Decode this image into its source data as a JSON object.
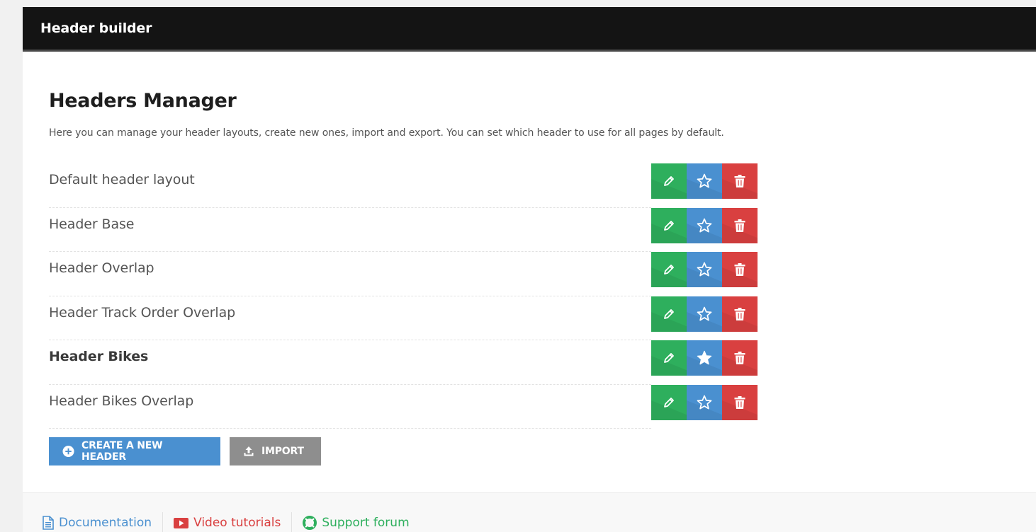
{
  "topbar": {
    "title": "Header builder"
  },
  "main": {
    "title": "Headers Manager",
    "description": "Here you can manage your header layouts, create new ones, import and export. You can set which header to use for all pages by default."
  },
  "headers": [
    {
      "name": "Default header layout",
      "is_default": false
    },
    {
      "name": "Header Base",
      "is_default": false
    },
    {
      "name": "Header Overlap",
      "is_default": false
    },
    {
      "name": "Header Track Order Overlap",
      "is_default": false
    },
    {
      "name": "Header Bikes",
      "is_default": true
    },
    {
      "name": "Header Bikes Overlap",
      "is_default": false
    }
  ],
  "actions": {
    "icons": {
      "edit": "pencil-icon",
      "default": "star-icon",
      "delete": "trash-icon"
    },
    "colors": {
      "edit": "#2eaf5d",
      "default": "#4a90d0",
      "delete": "#d94040"
    }
  },
  "buttons": {
    "create_label": "CREATE A NEW HEADER",
    "create_icon": "plus-circle-icon",
    "import_label": "IMPORT",
    "import_icon": "upload-icon"
  },
  "footer": {
    "documentation": "Documentation",
    "video": "Video tutorials",
    "support": "Support forum"
  }
}
